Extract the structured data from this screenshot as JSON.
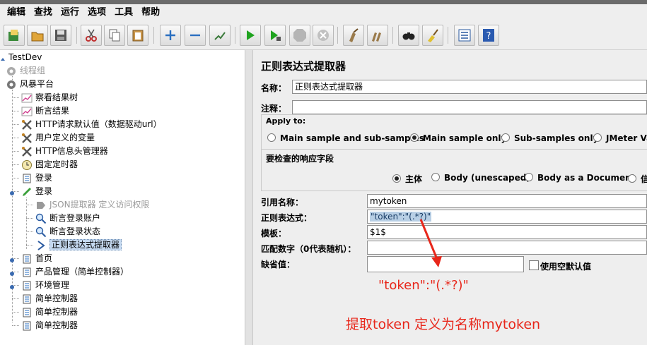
{
  "menu": [
    "编辑",
    "查找",
    "运行",
    "选项",
    "工具",
    "帮助"
  ],
  "toolbar_icons": [
    "templates-icon",
    "open-icon",
    "save-icon",
    "cut-icon",
    "copy-icon",
    "paste-icon",
    "expand-icon",
    "collapse-icon",
    "toggle-icon",
    "start-icon",
    "start-no-pause-icon",
    "stop-icon",
    "shutdown-icon",
    "clear-icon",
    "clear-all-icon",
    "search-icon",
    "reset-search-icon",
    "function-helper-icon",
    "help-icon"
  ],
  "tree": {
    "root": "TestDev",
    "thread_group": "线程组",
    "platform": "风暴平台",
    "items": [
      "察看结果树",
      "断言结果",
      "HTTP请求默认值（数据驱动url）",
      "用户定义的变量",
      "HTTP信息头管理器",
      "固定定时器",
      "登录",
      "登录",
      "JSON提取器 定义访问权限",
      "断言登录账户",
      "断言登录状态",
      "正则表达式提取器",
      "首页",
      "产品管理（简单控制器）",
      "环境管理",
      "简单控制器",
      "简单控制器",
      "简单控制器"
    ]
  },
  "panel": {
    "title": "正则表达式提取器",
    "name_label": "名称：",
    "name_value": "正则表达式提取器",
    "comment_label": "注释：",
    "comment_value": "",
    "apply_to_label": "Apply to:",
    "apply_options": [
      "Main sample and sub-samples",
      "Main sample only",
      "Sub-samples only",
      "JMeter Va"
    ],
    "apply_selected": "Main sample only",
    "response_field_label": "要检查的响应字段",
    "response_options": [
      "主体",
      "Body (unescaped)",
      "Body as a Document",
      "信"
    ],
    "response_selected": "主体",
    "ref_name_label": "引用名称：",
    "ref_name_value": "mytoken",
    "regex_label": "正则表达式：",
    "regex_value": "\"token\":\"(.*?)\"",
    "template_label": "模板：",
    "template_value": "$1$",
    "match_no_label": "匹配数字（0代表随机）：",
    "match_no_value": "",
    "default_label": "缺省值：",
    "default_value": "",
    "use_empty_default_label": "使用空默认值"
  },
  "annotations": {
    "regex_note": "\"token\":\"(.*?)\"",
    "explanation": "提取token 定义为名称mytoken",
    "color": "#e8271b"
  }
}
